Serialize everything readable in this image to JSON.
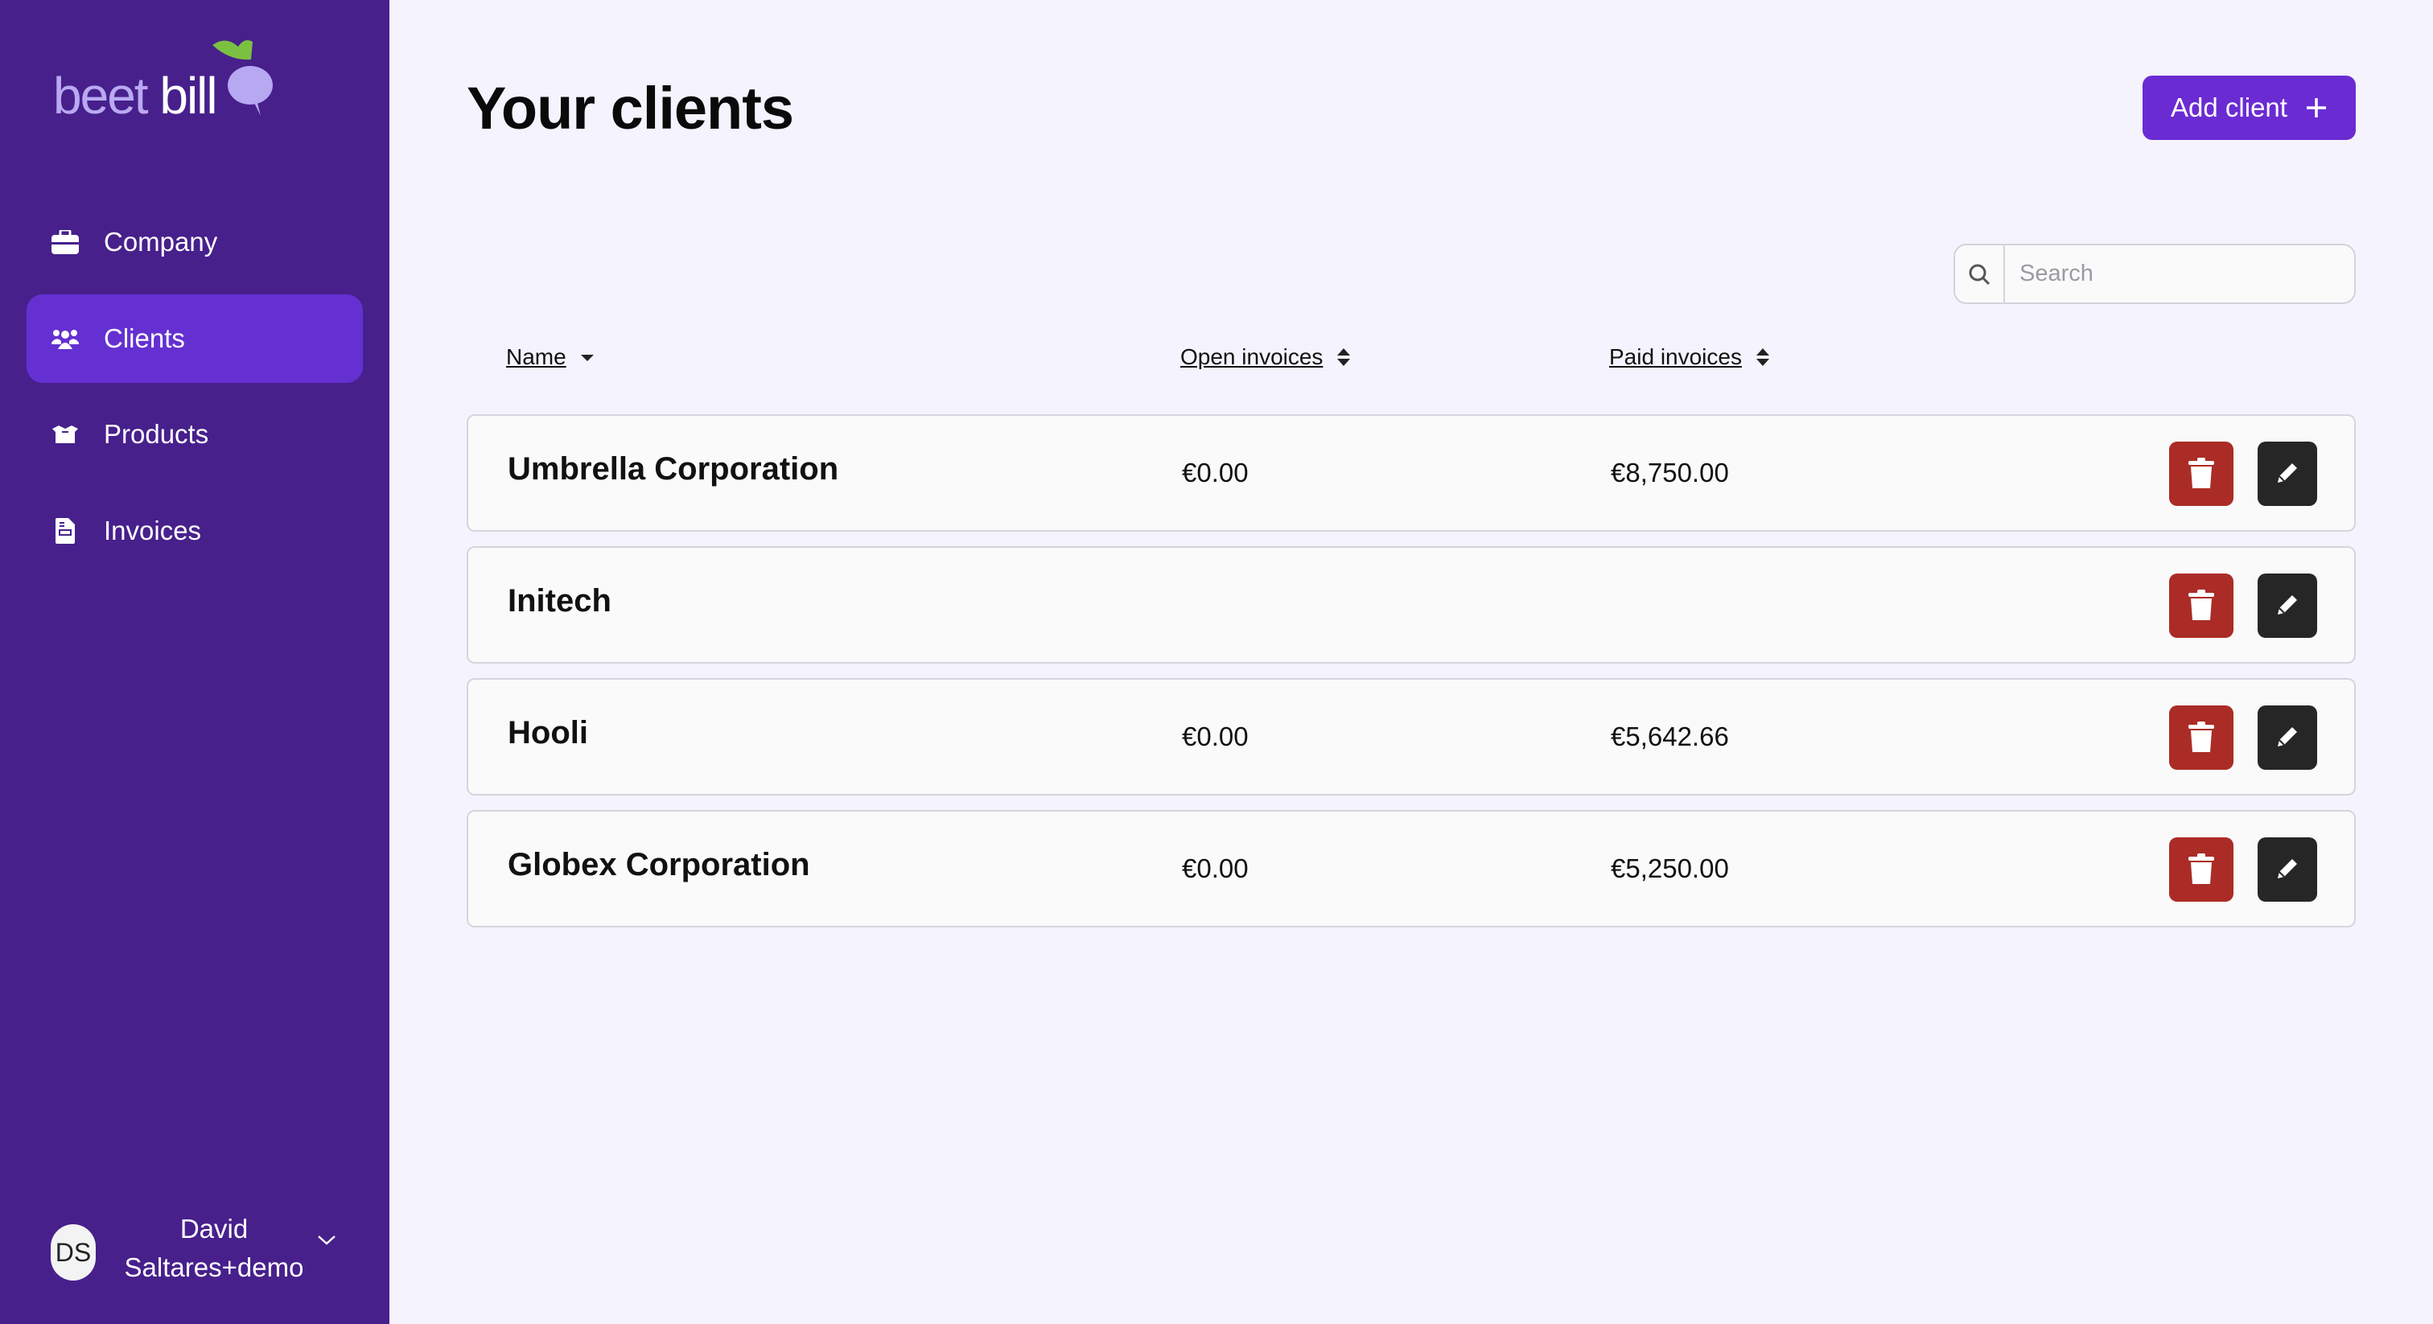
{
  "brand": {
    "part1": "beet",
    "part2": "bill"
  },
  "sidebar": {
    "items": [
      {
        "label": "Company",
        "icon": "briefcase-icon"
      },
      {
        "label": "Clients",
        "icon": "users-icon",
        "active": true
      },
      {
        "label": "Products",
        "icon": "box-icon"
      },
      {
        "label": "Invoices",
        "icon": "file-invoice-icon"
      }
    ]
  },
  "user": {
    "initials": "DS",
    "name": "David Saltares+demo"
  },
  "header": {
    "title": "Your clients",
    "add_label": "Add client"
  },
  "search": {
    "placeholder": "Search",
    "value": ""
  },
  "table": {
    "columns": [
      {
        "label": "Name",
        "sort": "desc"
      },
      {
        "label": "Open invoices",
        "sort": "none"
      },
      {
        "label": "Paid invoices",
        "sort": "none"
      }
    ],
    "rows": [
      {
        "name": "Umbrella Corporation",
        "open": "€0.00",
        "paid": "€8,750.00"
      },
      {
        "name": "Initech",
        "open": "",
        "paid": ""
      },
      {
        "name": "Hooli",
        "open": "€0.00",
        "paid": "€5,642.66"
      },
      {
        "name": "Globex Corporation",
        "open": "€0.00",
        "paid": "€5,250.00"
      }
    ]
  },
  "colors": {
    "sidebar": "#47208c",
    "active": "#6430d2",
    "primary": "#6a2bd3",
    "danger": "#ab2c26",
    "dark": "#262626"
  }
}
